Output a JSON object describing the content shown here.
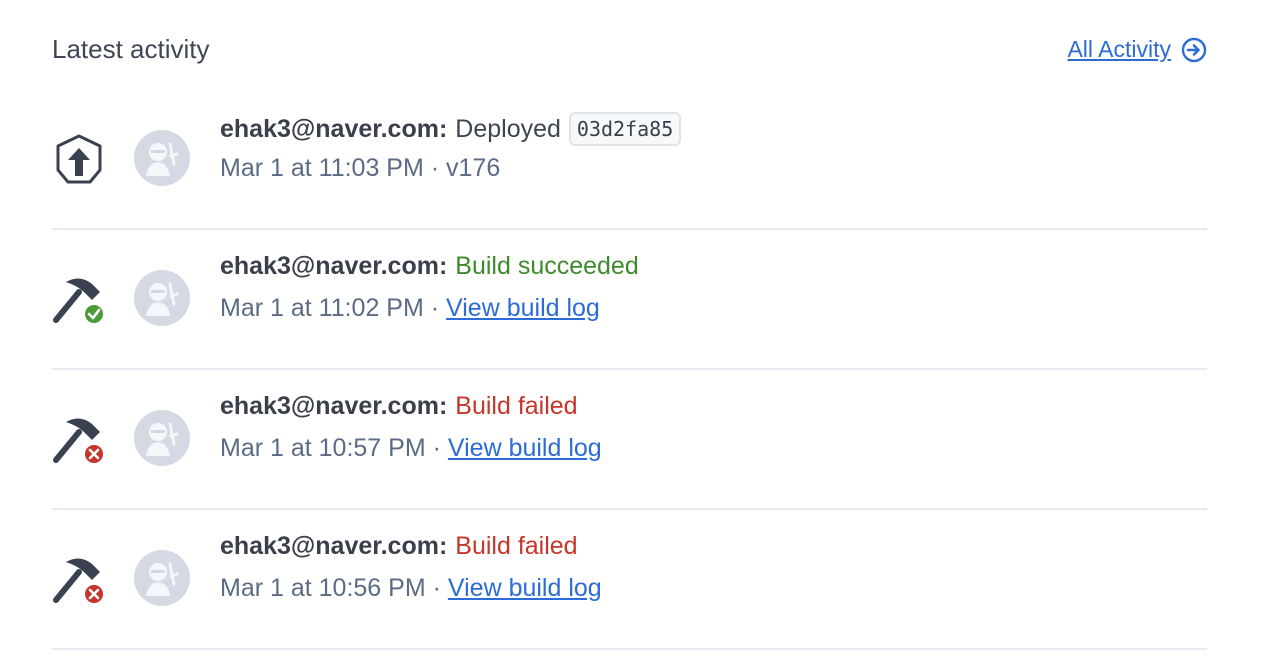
{
  "header": {
    "title": "Latest activity",
    "all_activity_label": "All Activity"
  },
  "colors": {
    "link": "#2d6cd6",
    "success": "#3f8a2c",
    "failed": "#c33629",
    "text": "#3d4452",
    "muted": "#5c6b85"
  },
  "activities": [
    {
      "icon": "deploy-icon",
      "user": "ehak3@naver.com:",
      "action": "Deployed",
      "commit": "03d2fa85",
      "timestamp": "Mar 1 at 11:03 PM",
      "separator": "·",
      "detail": "v176"
    },
    {
      "icon": "build-succeeded-icon",
      "user": "ehak3@naver.com:",
      "action": "Build succeeded",
      "timestamp": "Mar 1 at 11:02 PM",
      "separator": "·",
      "link": "View build log"
    },
    {
      "icon": "build-failed-icon",
      "user": "ehak3@naver.com:",
      "action": "Build failed",
      "timestamp": "Mar 1 at 10:57 PM",
      "separator": "·",
      "link": "View build log"
    },
    {
      "icon": "build-failed-icon",
      "user": "ehak3@naver.com:",
      "action": "Build failed",
      "timestamp": "Mar 1 at 10:56 PM",
      "separator": "·",
      "link": "View build log"
    }
  ]
}
